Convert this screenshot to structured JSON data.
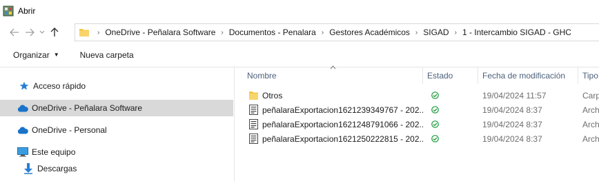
{
  "window": {
    "title": "Abrir"
  },
  "address": {
    "crumbs": [
      "OneDrive - Peñalara Software",
      "Documentos - Penalara",
      "Gestores Académicos",
      "SIGAD",
      "1 - Intercambio SIGAD - GHC"
    ]
  },
  "toolbar": {
    "organize_label": "Organizar",
    "new_folder_label": "Nueva carpeta"
  },
  "nav": {
    "items": [
      {
        "label": "Acceso rápido",
        "icon": "star-icon"
      },
      {
        "label": "OneDrive - Peñalara Software",
        "icon": "cloud-icon",
        "selected": true
      },
      {
        "label": "OneDrive - Personal",
        "icon": "cloud-icon"
      },
      {
        "label": "Este equipo",
        "icon": "computer-icon"
      },
      {
        "label": "Descargas",
        "icon": "download-arrow-icon"
      }
    ]
  },
  "list": {
    "columns": {
      "name": "Nombre",
      "state": "Estado",
      "date": "Fecha de modificación",
      "type": "Tipo"
    },
    "rows": [
      {
        "name": "Otros",
        "kind": "folder",
        "date": "19/04/2024 11:57",
        "type": "Carp"
      },
      {
        "name": "peñalaraExportacion1621239349767 - 202...",
        "kind": "file",
        "date": "19/04/2024 8:37",
        "type": "Arch"
      },
      {
        "name": "peñalaraExportacion1621248791066 - 202...",
        "kind": "file",
        "date": "19/04/2024 8:37",
        "type": "Arch"
      },
      {
        "name": "peñalaraExportacion1621250222815 - 202...",
        "kind": "file",
        "date": "19/04/2024 8:37",
        "type": "Arch"
      }
    ]
  },
  "colors": {
    "selected_bg": "#d9d9d9",
    "folder": "#f4c542",
    "ok_green": "#1e9a3c",
    "cloud_blue": "#1a73c9"
  }
}
